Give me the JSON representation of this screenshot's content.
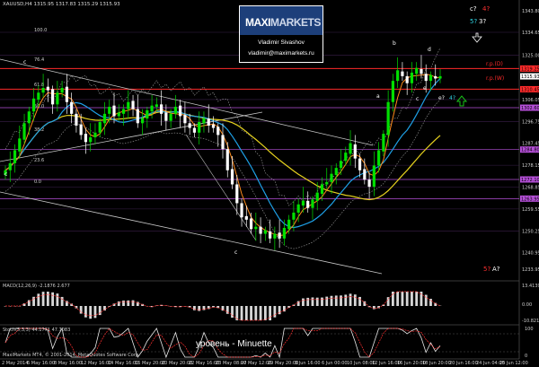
{
  "window": {
    "symbol_line": "XAUUSD,H4  1315.95 1317.83 1315.29 1315.93"
  },
  "watermark": {
    "brand_part1": "MAXI",
    "brand_part2": "MARKETS",
    "author": "Vladimir Sivashov",
    "email": "vladimir@maximarkets.ru"
  },
  "caption": "уровень - Minuette",
  "colors": {
    "background": "#000000",
    "candle_up": "#00e000",
    "candle_down": "#ffffff",
    "ma_fast": "#ff8c1a",
    "ma_mid": "#1ea0e6",
    "ma_slow": "#e6d21e",
    "resistance": "#ff2a2a",
    "magenta_levels": "#b54fd8",
    "trendline": "#d0d0d0",
    "wave_cyan": "#30d8e8",
    "wave_red": "#ff3030",
    "arrow_green": "#18c018"
  },
  "price_axis": {
    "labels": [
      "1343.80",
      "1334.65",
      "1325.00",
      "1315.35",
      "1306.05",
      "1296.75",
      "1287.45",
      "1278.15",
      "1268.85",
      "1259.55",
      "1250.25",
      "1240.95",
      "1233.95"
    ],
    "tags": [
      {
        "text": "1319.25",
        "color": "#ff2a2a"
      },
      {
        "text": "1315.93",
        "color": "#ffffff"
      },
      {
        "text": "1310.45",
        "color": "#ff2a2a"
      },
      {
        "text": "1302.60",
        "color": "#b54fd8"
      },
      {
        "text": "1284.80",
        "color": "#b54fd8"
      },
      {
        "text": "1272.10",
        "color": "#b54fd8"
      },
      {
        "text": "1263.95",
        "color": "#b54fd8"
      }
    ]
  },
  "macd_axis": [
    "13.4139",
    "0.00",
    "-10.821"
  ],
  "stoch_axis": [
    "100",
    "0"
  ],
  "macd_title": "MACD(12,26,9) -2.1876 2.677",
  "stoch_title": "Stoch(5,3,3) 44.1771 47.7083",
  "footer_left": "MaxiMarkets MT4, © 2001-2014, MetaQuotes Software Corp.",
  "time_axis": [
    "2 May 2014",
    "6 May 16:00",
    "8 May 16:00",
    "12 May 16:00",
    "14 May 16:00",
    "16 May 20:00",
    "20 May 20:00",
    "22 May 16:00",
    "23 May 08:00",
    "27 May 12:00",
    "29 May 20:00",
    "3 Jun 16:00",
    "6 Jun 00:00",
    "10 Jun 08:00",
    "12 Jun 16:00",
    "16 Jun 20:00",
    "18 Jun 20:00",
    "20 Jun 16:00",
    "24 Jun 04:00",
    "25 Jun 12:00",
    "27 Jun 20:00"
  ],
  "fib_labels": [
    "100.0",
    "76.4",
    "61.8",
    "50.0",
    "38.2",
    "23.6",
    "0.0"
  ],
  "level_labels": {
    "res1": "r.p.(D)",
    "res2": "r.p.(W)"
  },
  "wave_labels": {
    "top_right_1": "c?",
    "top_right_2": "4?",
    "top_right_3": "5?",
    "top_right_4": "3?",
    "bottom_right_1": "5?",
    "bottom_right_2": "A?",
    "mid_right_1": "e?",
    "mid_right_2": "4?",
    "a": "a",
    "b": "b",
    "c": "c",
    "d": "d",
    "e": "e"
  },
  "chart_data": {
    "type": "candlestick",
    "symbol": "XAUUSD",
    "timeframe": "H4",
    "ylim": [
      1233.95,
      1343.8
    ],
    "close_last": 1315.93,
    "resistance_levels": [
      1319.25,
      1310.45
    ],
    "support_levels": [
      1302.6,
      1284.8,
      1272.1,
      1263.95
    ],
    "price_path": [
      1276,
      1279,
      1284,
      1289,
      1296,
      1301,
      1306,
      1309,
      1311,
      1310,
      1304,
      1309,
      1311,
      1305,
      1300,
      1295,
      1291,
      1288,
      1290,
      1292,
      1296,
      1300,
      1303,
      1299,
      1300,
      1302,
      1305,
      1302,
      1296,
      1298,
      1301,
      1303,
      1304,
      1300,
      1297,
      1300,
      1303,
      1299,
      1296,
      1294,
      1292,
      1296,
      1298,
      1295,
      1294,
      1291,
      1285,
      1276,
      1270,
      1262,
      1256,
      1255,
      1251,
      1252,
      1249,
      1250,
      1247,
      1249,
      1247,
      1251,
      1255,
      1258,
      1261,
      1263,
      1260,
      1263,
      1266,
      1270,
      1271,
      1274,
      1277,
      1280,
      1283,
      1287,
      1281,
      1276,
      1272,
      1269,
      1278,
      1284,
      1291,
      1305,
      1314,
      1318,
      1316,
      1313,
      1317,
      1319,
      1317,
      1314,
      1316,
      1315,
      1316
    ]
  }
}
